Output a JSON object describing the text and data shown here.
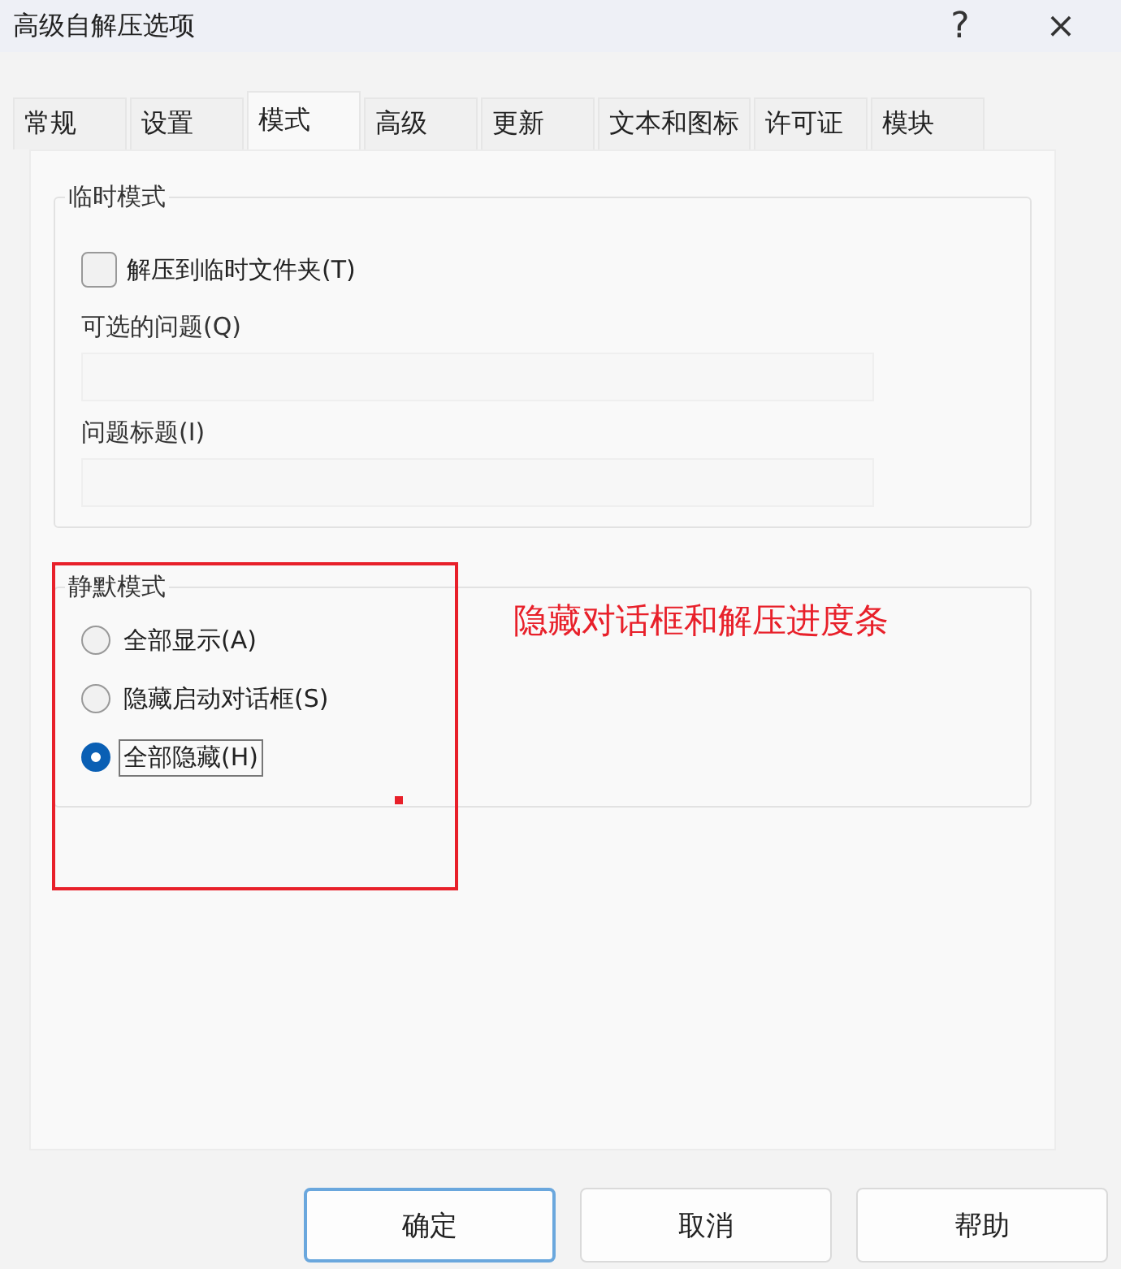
{
  "window": {
    "title": "高级自解压选项",
    "help": "?",
    "close": "×"
  },
  "tabs": [
    {
      "label": "常规",
      "selected": false
    },
    {
      "label": "设置",
      "selected": false
    },
    {
      "label": "模式",
      "selected": true
    },
    {
      "label": "高级",
      "selected": false
    },
    {
      "label": "更新",
      "selected": false
    },
    {
      "label": "文本和图标",
      "selected": false
    },
    {
      "label": "许可证",
      "selected": false
    },
    {
      "label": "模块",
      "selected": false
    }
  ],
  "temp_mode": {
    "title": "临时模式",
    "checkbox": {
      "label": "解压到临时文件夹(T)",
      "checked": false
    },
    "fields": [
      {
        "label": "可选的问题(Q)"
      },
      {
        "label": "问题标题(I)"
      }
    ]
  },
  "silent_mode": {
    "title": "静默模式",
    "options": [
      {
        "label": "全部显示(A)",
        "selected": false
      },
      {
        "label": "隐藏启动对话框(S)",
        "selected": false
      },
      {
        "label": "全部隐藏(H)",
        "selected": true
      }
    ]
  },
  "annotation": {
    "text": "隐藏对话框和解压进度条",
    "color": "#e8202a"
  },
  "buttons": [
    {
      "label": "确定",
      "selected": true
    },
    {
      "label": "取消",
      "selected": false
    },
    {
      "label": "帮助",
      "selected": false
    }
  ]
}
